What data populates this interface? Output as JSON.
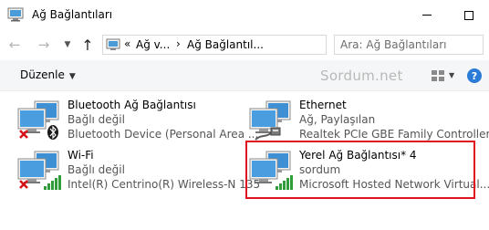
{
  "window": {
    "title": "Ağ Bağlantıları"
  },
  "address": {
    "prefix": "«",
    "segments": [
      "Ağ v...",
      "Ağ Bağlantıl..."
    ],
    "separator": "›",
    "search_placeholder": "Ara: Ağ Bağlantıları"
  },
  "toolbar": {
    "organize_label": "Düzenle",
    "watermark": "Sordum.net"
  },
  "connections": [
    {
      "name": "Bluetooth Ağ Bağlantısı",
      "status": "Bağlı değil",
      "device": "Bluetooth Device (Personal Area ...",
      "icon": "network-monitor-icon",
      "overlay": "red-x-icon",
      "badge": "bluetooth-icon"
    },
    {
      "name": "Ethernet",
      "status": "Ağ, Paylaşılan",
      "device": "Realtek PCIe GBE Family Controller",
      "icon": "ethernet-cable-icon"
    },
    {
      "name": "Wi-Fi",
      "status": "Bağlı değil",
      "device": "Intel(R) Centrino(R) Wireless-N 135",
      "icon": "network-monitor-icon",
      "overlay": "red-x-icon",
      "badge": "signal-bars-icon"
    },
    {
      "name": "Yerel Ağ Bağlantısı* 4",
      "status": "sordum",
      "device": "Microsoft Hosted Network Virtual...",
      "icon": "network-monitor-icon",
      "badge": "signal-bars-icon",
      "highlighted": true
    }
  ],
  "colors": {
    "highlight": "#e0141e",
    "accent": "#2b7bd7",
    "signal": "#2e9d3a"
  }
}
